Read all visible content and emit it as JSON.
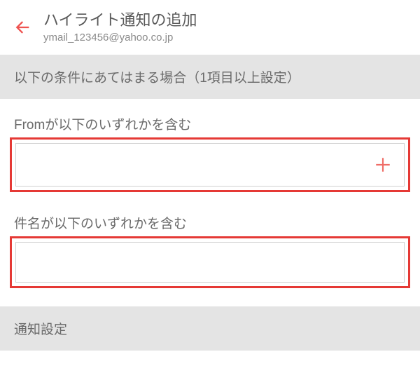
{
  "header": {
    "title": "ハイライト通知の追加",
    "subtitle": "ymail_123456@yahoo.co.jp"
  },
  "sections": {
    "conditions_header": "以下の条件にあてはまる場合（1項目以上設定）",
    "from_label": "Fromが以下のいずれかを含む",
    "subject_label": "件名が以下のいずれかを含む",
    "notification_header": "通知設定"
  },
  "colors": {
    "accent": "#e53935",
    "arrow": "#ef5350",
    "plus": "#ef6d67"
  }
}
